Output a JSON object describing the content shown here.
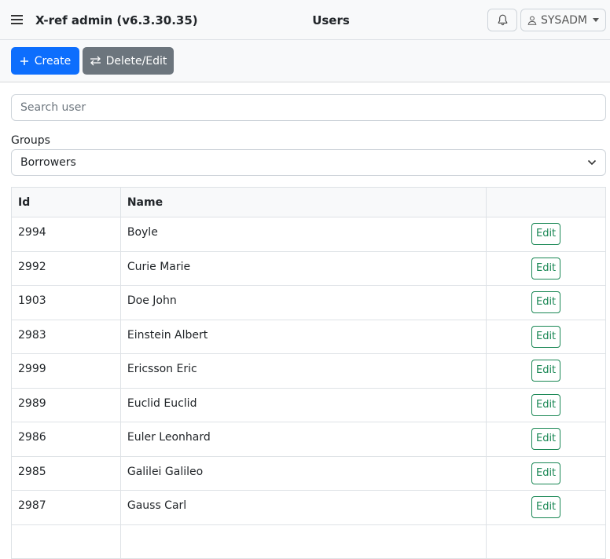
{
  "header": {
    "app_title": "X-ref admin (v6.3.30.35)",
    "page_title": "Users",
    "user_label": "SYSADM"
  },
  "toolbar": {
    "create_label": "Create",
    "delete_edit_label": "Delete/Edit"
  },
  "search": {
    "placeholder": "Search user",
    "value": ""
  },
  "groups": {
    "label": "Groups",
    "selected": "Borrowers"
  },
  "table": {
    "columns": [
      "Id",
      "Name",
      ""
    ],
    "edit_label": "Edit",
    "rows": [
      {
        "id": "2994",
        "name": "Boyle"
      },
      {
        "id": "2992",
        "name": "Curie Marie"
      },
      {
        "id": "1903",
        "name": "Doe John"
      },
      {
        "id": "2983",
        "name": "Einstein Albert"
      },
      {
        "id": "2999",
        "name": "Ericsson Eric"
      },
      {
        "id": "2989",
        "name": "Euclid Euclid"
      },
      {
        "id": "2986",
        "name": "Euler Leonhard"
      },
      {
        "id": "2985",
        "name": "Galilei Galileo"
      },
      {
        "id": "2987",
        "name": "Gauss Carl"
      },
      {
        "id": "",
        "name": ""
      }
    ]
  },
  "colors": {
    "primary": "#0d6efd",
    "secondary": "#6c757d",
    "success": "#198754"
  },
  "icons": {
    "menu": "hamburger-icon",
    "notifications": "bell-icon",
    "user": "person-icon",
    "create": "plus-icon",
    "delete_edit": "arrows-swap-icon",
    "select": "chevron-down-icon"
  }
}
